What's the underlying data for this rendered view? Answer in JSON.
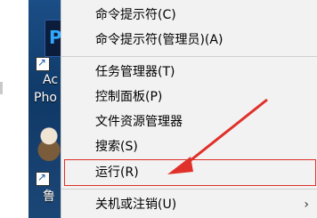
{
  "desktop": {
    "icon1_label_line1": "Ac",
    "icon1_label_line2": "Pho",
    "icon1_glyph": "P",
    "icon2_label": "鲁"
  },
  "menu": {
    "items": [
      {
        "label": "命令提示符(C)"
      },
      {
        "label": "命令提示符(管理员)(A)"
      },
      {
        "label": "任务管理器(T)"
      },
      {
        "label": "控制面板(P)"
      },
      {
        "label": "文件资源管理器"
      },
      {
        "label": "搜索(S)"
      },
      {
        "label": "运行(R)"
      },
      {
        "label": "关机或注销(U)"
      }
    ],
    "submenu_glyph": "›"
  },
  "annotation": {
    "color": "#e0302a"
  }
}
